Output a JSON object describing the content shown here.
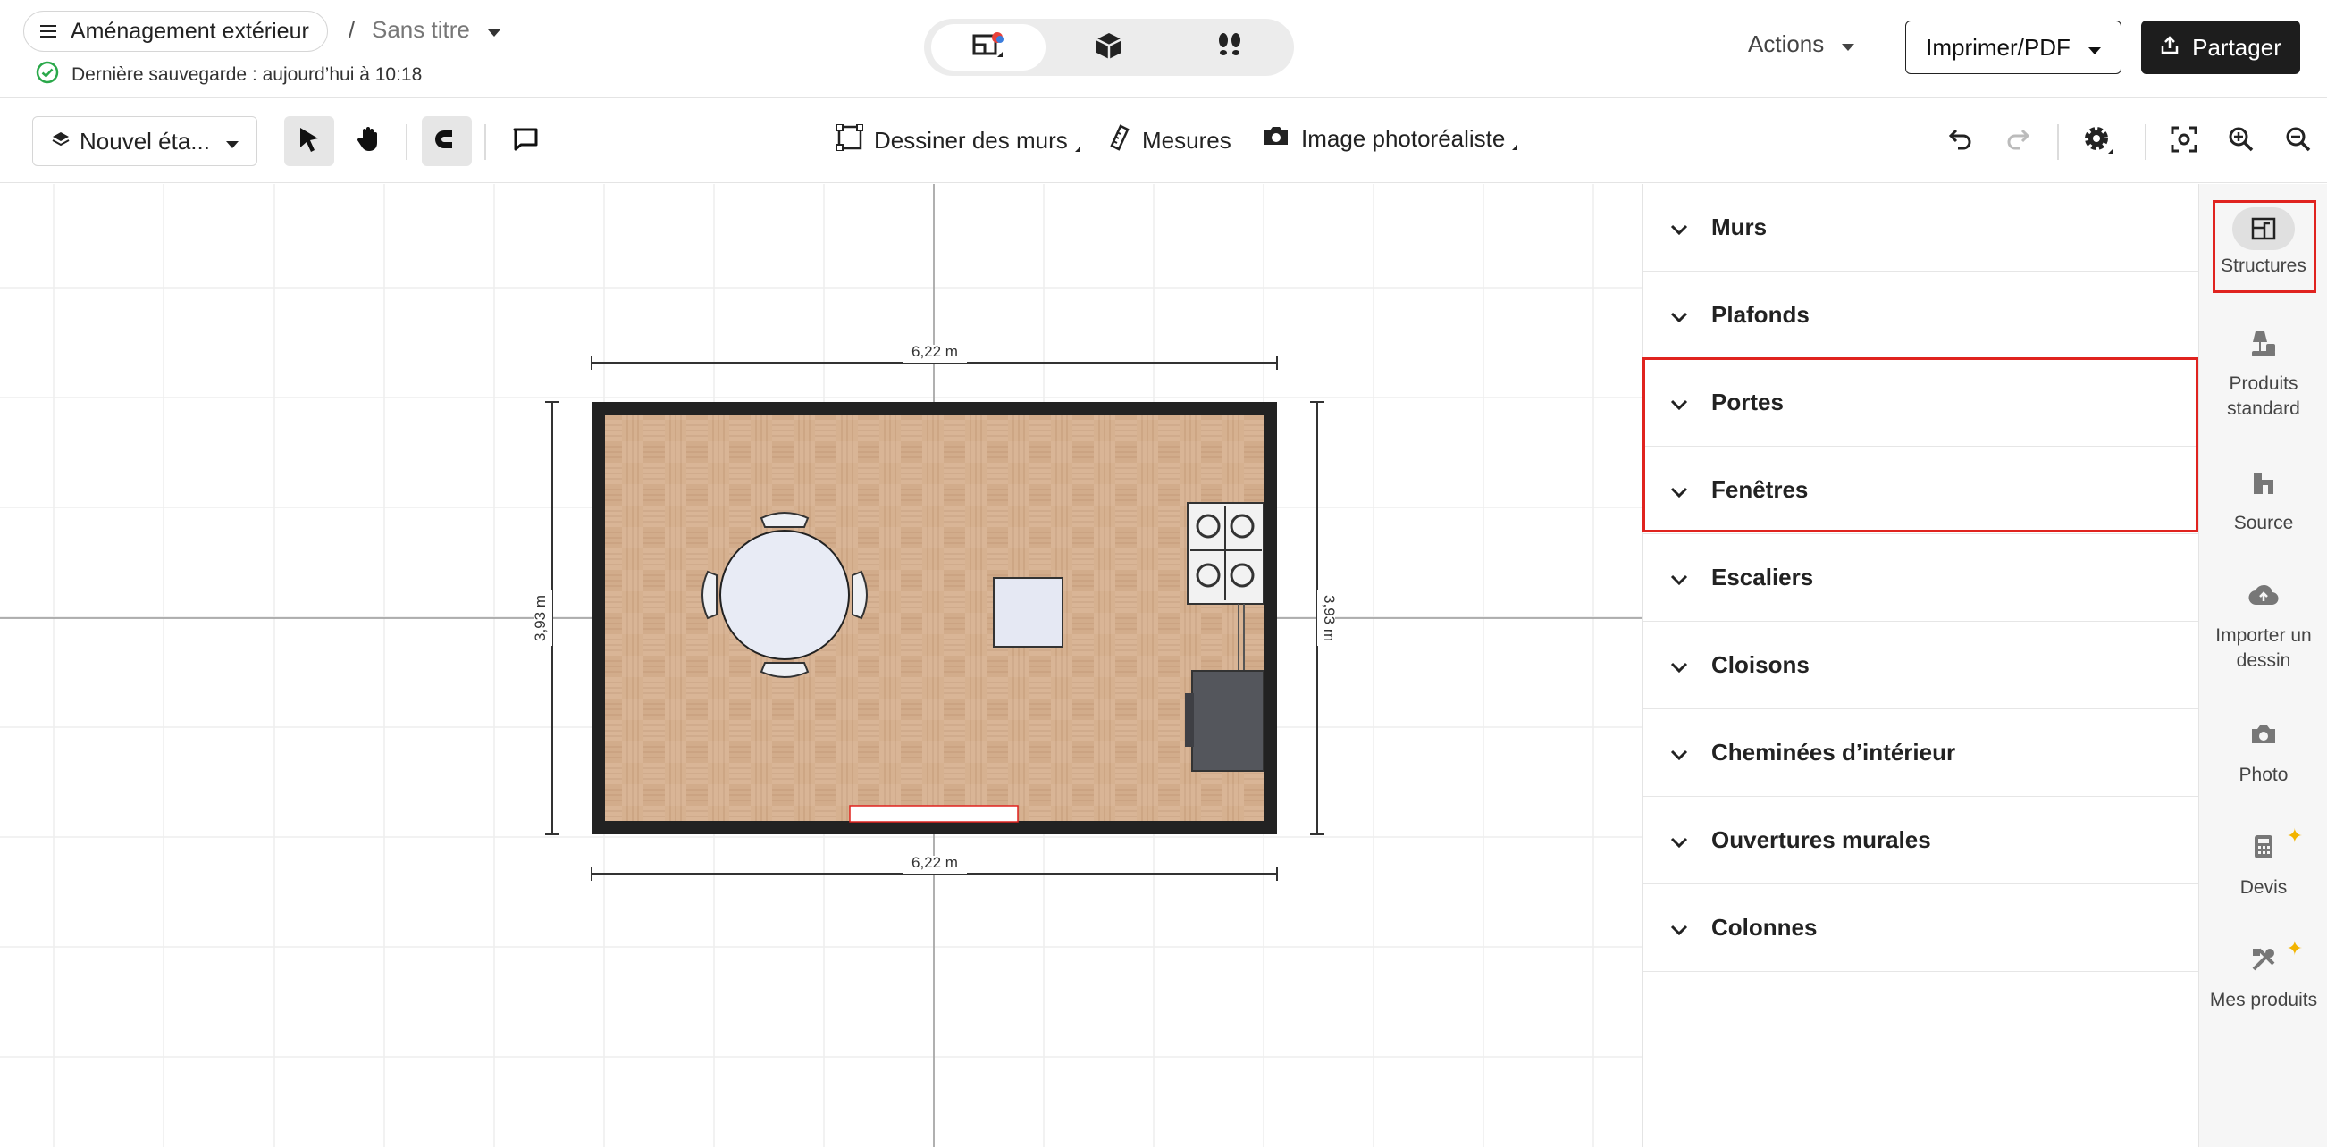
{
  "header": {
    "project_name": "Aménagement extérieur",
    "separator": "/",
    "doc_title": "Sans titre",
    "save_status": "Dernière sauvegarde : aujourd’hui à 10:18",
    "actions_label": "Actions",
    "print_label": "Imprimer/PDF",
    "share_label": "Partager",
    "view_modes": [
      "plan-2d-icon",
      "view-3d-icon",
      "walkthrough-icon"
    ]
  },
  "toolbar": {
    "level_label": "Nouvel éta...",
    "draw_walls_label": "Dessiner des murs",
    "measures_label": "Mesures",
    "photo_image_label": "Image photoréaliste"
  },
  "canvas": {
    "dim_top": "6,22 m",
    "dim_bottom": "6,22 m",
    "dim_left": "3,93 m",
    "dim_right": "3,93 m"
  },
  "panel": {
    "items": [
      {
        "label": "Murs"
      },
      {
        "label": "Plafonds"
      },
      {
        "label": "Portes"
      },
      {
        "label": "Fenêtres"
      },
      {
        "label": "Escaliers"
      },
      {
        "label": "Cloisons"
      },
      {
        "label": "Cheminées d’intérieur"
      },
      {
        "label": "Ouvertures murales"
      },
      {
        "label": "Colonnes"
      }
    ]
  },
  "rail": {
    "items": [
      {
        "label": "Structures"
      },
      {
        "label": "Produits standard"
      },
      {
        "label": "Source"
      },
      {
        "label": "Importer un dessin"
      },
      {
        "label": "Photo"
      },
      {
        "label": "Devis"
      },
      {
        "label": "Mes produits"
      }
    ]
  },
  "colors": {
    "highlight": "#e0231f",
    "dark_button": "#1d1d1d",
    "save_ok": "#2aa84a",
    "floor": "#d9b596",
    "wall": "#222222"
  }
}
